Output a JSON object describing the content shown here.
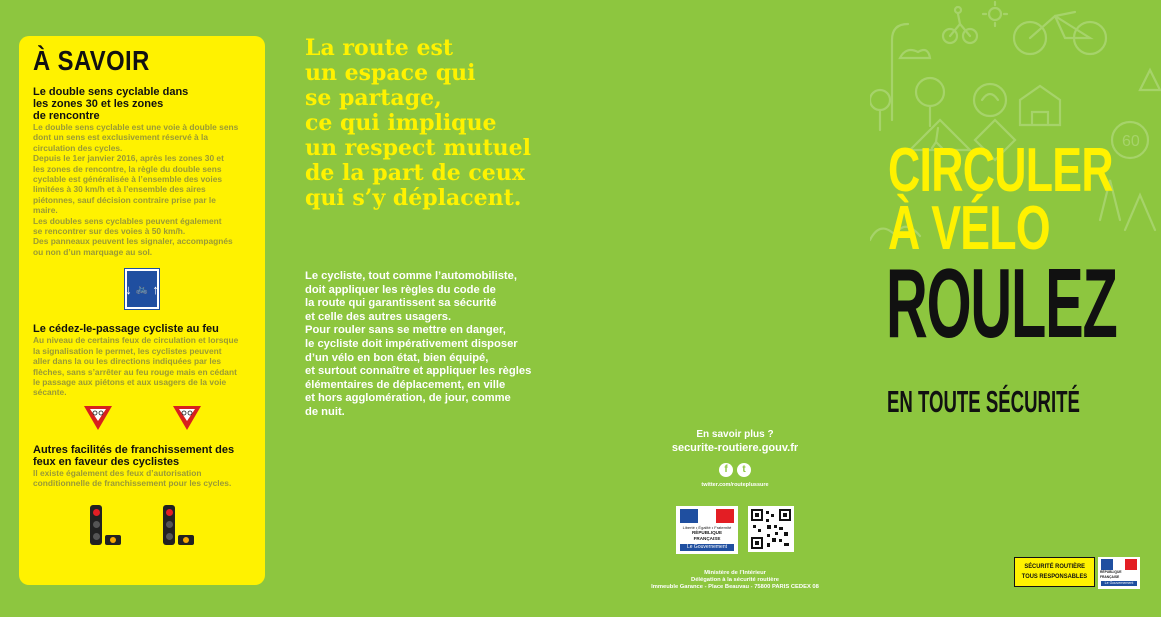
{
  "left_panel": {
    "heading": "À SAVOIR",
    "sections": [
      {
        "title": "Le double sens cyclable dans les zones 30 et les zones de rencontre",
        "title_lines": [
          "Le double sens cyclable dans",
          "les zones 30 et les zones",
          "de rencontre"
        ],
        "body_lines": [
          "Le double sens cyclable est une voie à double sens",
          "dont un sens est exclusivement réservé à la",
          "circulation des cycles.",
          "Depuis le 1er janvier 2016, après les zones 30 et",
          "les zones de rencontre, la règle du double sens",
          "cyclable est généralisée à l’ensemble des voies",
          "limitées à 30 km/h et à l’ensemble des aires",
          "piétonnes, sauf décision contraire prise par le",
          "maire.",
          "Les doubles sens cyclables peuvent également",
          "se rencontrer sur des voies à 50 km/h.",
          "Des panneaux peuvent les signaler, accompagnés",
          "ou non d’un marquage au sol."
        ]
      },
      {
        "title": "Le cédez-le-passage cycliste au feu",
        "title_lines": [
          "Le cédez-le-passage cycliste au feu"
        ],
        "body_lines": [
          "Au niveau de certains feux de circulation et lorsque",
          "la signalisation le permet, les cyclistes peuvent",
          "aller dans la ou les directions indiquées par les",
          "flèches, sans s’arrêter au feu rouge mais en cédant",
          "le passage aux piétons et aux usagers de la voie",
          "sécante."
        ]
      },
      {
        "title": "Autres facilités de franchissement des feux en faveur des cyclistes",
        "title_lines": [
          "Autres facilités de franchissement des",
          "feux en faveur des cyclistes"
        ],
        "body_lines": [
          "Il existe également des feux d’autorisation",
          "conditionnelle de franchissement pour les cycles."
        ]
      }
    ]
  },
  "slogan_lines": [
    "La route est",
    "un  espace qui",
    "se partage,",
    "ce qui implique",
    "un respect mutuel",
    "de la part de ceux",
    "qui s’y déplacent."
  ],
  "intro_lines": [
    "Le cycliste, tout comme l’automobiliste,",
    "doit appliquer les règles du code de",
    "la route qui garantissent sa sécurité",
    "et celle des autres usagers.",
    "Pour rouler sans se mettre en danger,",
    "le cycliste doit impérativement disposer",
    "d’un vélo en bon état, bien équipé,",
    "et surtout connaître et appliquer les règles",
    "élémentaires de déplacement, en ville",
    "et hors agglomération, de jour, comme",
    "de nuit."
  ],
  "contact": {
    "question": "En savoir plus ?",
    "url": "securite-routiere.gouv.fr",
    "twitter": "twitter.com/routeplussure",
    "address_lines": [
      "Ministère de l’Intérieur",
      "Délégation à la sécurité routière",
      "Immeuble Garance - Place Beauvau - 75800 PARIS CEDEX 08"
    ]
  },
  "gov_logo": {
    "motto": "Liberté • Égalité • Fraternité",
    "republic": "RÉPUBLIQUE FRANÇAISE",
    "gov": "Le Gouvernement"
  },
  "cover": {
    "title_line1": "CIRCULER",
    "title_line2": "À VÉLO",
    "title_line3": "ROULEZ",
    "title_line4": "EN TOUTE SÉCURITÉ",
    "badge_line1": "SÉCURITÉ ROUTIÈRE",
    "badge_line2": "TOUS RESPONSABLES"
  },
  "colors": {
    "background": "#8dc63f",
    "yellow": "#fff200",
    "black": "#111111",
    "white": "#ffffff"
  }
}
